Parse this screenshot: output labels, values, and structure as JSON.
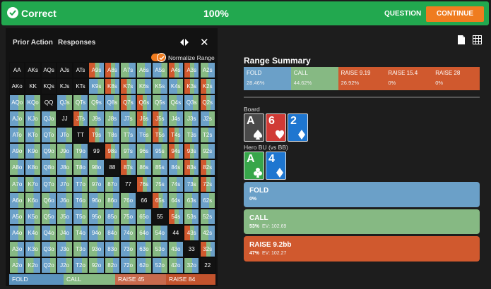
{
  "topbar": {
    "status": "Correct",
    "percent": "100%",
    "question": "QUESTION",
    "continue": "CONTINUE"
  },
  "left_panel": {
    "tabs": [
      "Prior Action",
      "Responses"
    ],
    "normalize_label": "Normalize Range",
    "legend": [
      {
        "label": "FOLD",
        "color": "#5b93be"
      },
      {
        "label": "CALL",
        "color": "#86b983"
      },
      {
        "label": "RAISE 45",
        "color": "#c86a4d"
      },
      {
        "label": "RAISE 84",
        "color": "#c2532d"
      }
    ]
  },
  "colors": {
    "fold": "#6ba0c8",
    "call": "#86b983",
    "raise": "#d0592e",
    "empty": "#121212"
  },
  "grid": [
    [
      "AA",
      "AKs",
      "AQs",
      "AJs",
      "ATs",
      "A9s",
      "A8s",
      "A7s",
      "A6s",
      "A5s",
      "A4s",
      "A3s",
      "A2s"
    ],
    [
      "AKo",
      "KK",
      "KQs",
      "KJs",
      "KTs",
      "K9s",
      "K8s",
      "K7s",
      "K6s",
      "K5s",
      "K4s",
      "K3s",
      "K2s"
    ],
    [
      "AQo",
      "KQo",
      "QQ",
      "QJs",
      "QTs",
      "Q9s",
      "Q8s",
      "Q7s",
      "Q6s",
      "Q5s",
      "Q4s",
      "Q3s",
      "Q2s"
    ],
    [
      "AJo",
      "KJo",
      "QJo",
      "JJ",
      "JTs",
      "J9s",
      "J8s",
      "J7s",
      "J6s",
      "J5s",
      "J4s",
      "J3s",
      "J2s"
    ],
    [
      "ATo",
      "KTo",
      "QTo",
      "JTo",
      "TT",
      "T9s",
      "T8s",
      "T7s",
      "T6s",
      "T5s",
      "T4s",
      "T3s",
      "T2s"
    ],
    [
      "A9o",
      "K9o",
      "Q9o",
      "J9o",
      "T9o",
      "99",
      "98s",
      "97s",
      "96s",
      "95s",
      "94s",
      "93s",
      "92s"
    ],
    [
      "A8o",
      "K8o",
      "Q8o",
      "J8o",
      "T8o",
      "98o",
      "88",
      "87s",
      "86s",
      "85s",
      "84s",
      "83s",
      "82s"
    ],
    [
      "A7o",
      "K7o",
      "Q7o",
      "J7o",
      "T7o",
      "97o",
      "87o",
      "77",
      "76s",
      "75s",
      "74s",
      "73s",
      "72s"
    ],
    [
      "A6o",
      "K6o",
      "Q6o",
      "J6o",
      "T6o",
      "96o",
      "86o",
      "76o",
      "66",
      "65s",
      "64s",
      "63s",
      "62s"
    ],
    [
      "A5o",
      "K5o",
      "Q5o",
      "J5o",
      "T5o",
      "95o",
      "85o",
      "75o",
      "65o",
      "55",
      "54s",
      "53s",
      "52s"
    ],
    [
      "A4o",
      "K4o",
      "Q4o",
      "J4o",
      "T4o",
      "94o",
      "84o",
      "74o",
      "64o",
      "54o",
      "44",
      "43s",
      "42s"
    ],
    [
      "A3o",
      "K3o",
      "Q3o",
      "J3o",
      "T3o",
      "93o",
      "83o",
      "73o",
      "63o",
      "53o",
      "43o",
      "33",
      "32s"
    ],
    [
      "A2o",
      "K2o",
      "Q2o",
      "J2o",
      "T2o",
      "92o",
      "82o",
      "72o",
      "62o",
      "52o",
      "42o",
      "32o",
      "22"
    ]
  ],
  "range_summary": {
    "title": "Range Summary",
    "segments": [
      {
        "name": "FOLD",
        "pct": "28.46%",
        "color": "#6ba0c8",
        "share": 0.2
      },
      {
        "name": "CALL",
        "pct": "44.62%",
        "color": "#86b983",
        "share": 0.2
      },
      {
        "name": "RAISE 9.19",
        "pct": "26.92%",
        "color": "#d0592e",
        "share": 0.2
      },
      {
        "name": "RAISE 15.4",
        "pct": "0%",
        "color": "#d0592e",
        "share": 0.2
      },
      {
        "name": "RAISE 28",
        "pct": "0%",
        "color": "#d0592e",
        "share": 0.2
      }
    ]
  },
  "board": {
    "label": "Board",
    "cards": [
      {
        "rank": "A",
        "suit": "spade",
        "color": "#4a4a4a"
      },
      {
        "rank": "6",
        "suit": "heart",
        "color": "#d03a35"
      },
      {
        "rank": "2",
        "suit": "diamond",
        "color": "#1e76d0"
      }
    ]
  },
  "hero": {
    "label": "Hero BU (vs BB)",
    "cards": [
      {
        "rank": "A",
        "suit": "club",
        "color": "#37a64a"
      },
      {
        "rank": "4",
        "suit": "diamond",
        "color": "#1e76d0"
      }
    ]
  },
  "actions": [
    {
      "name": "FOLD",
      "pct": "0%",
      "ev": "",
      "color": "#6ba0c8"
    },
    {
      "name": "CALL",
      "pct": "53%",
      "ev": "EV: 102.69",
      "color": "#86b983"
    },
    {
      "name": "RAISE 9.2bb",
      "pct": "47%",
      "ev": "EV: 102.27",
      "color": "#d0592e"
    }
  ]
}
